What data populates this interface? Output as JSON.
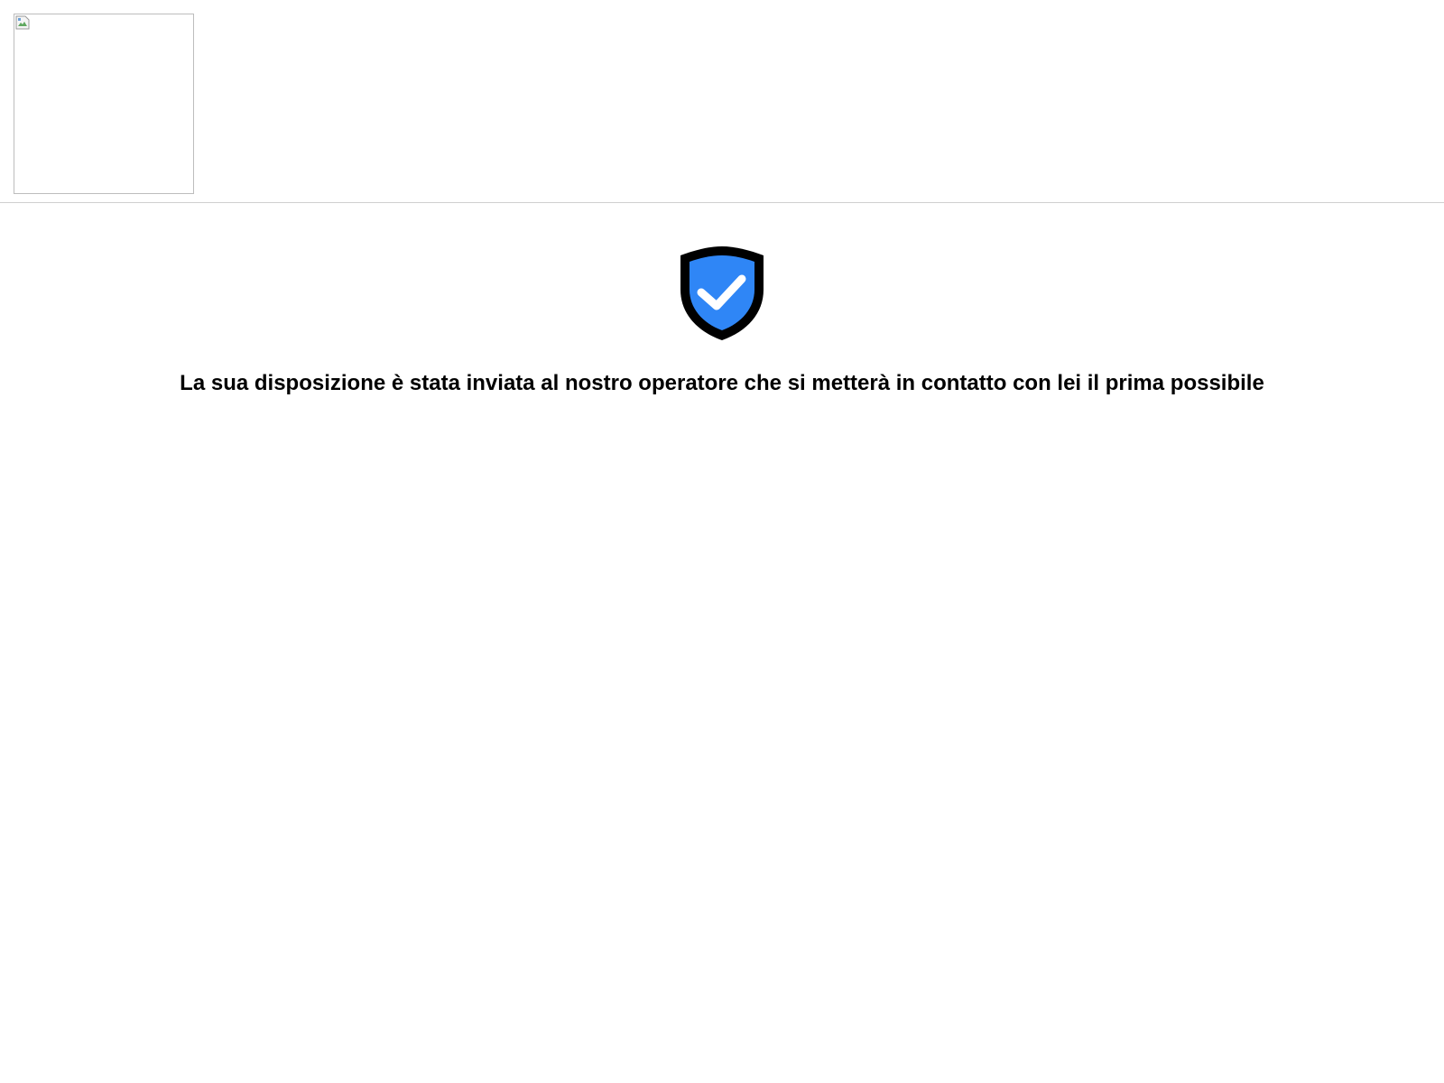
{
  "header": {
    "logo_icon": "broken-image-icon"
  },
  "main": {
    "status_icon": "shield-check-icon",
    "message": "La sua disposizione è stata inviata al nostro operatore che si metterà in contatto con lei il prima possibile"
  },
  "colors": {
    "shield_fill": "#2f86f6",
    "shield_outline": "#000000",
    "check": "#ffffff",
    "divider": "#cfcfcf"
  }
}
